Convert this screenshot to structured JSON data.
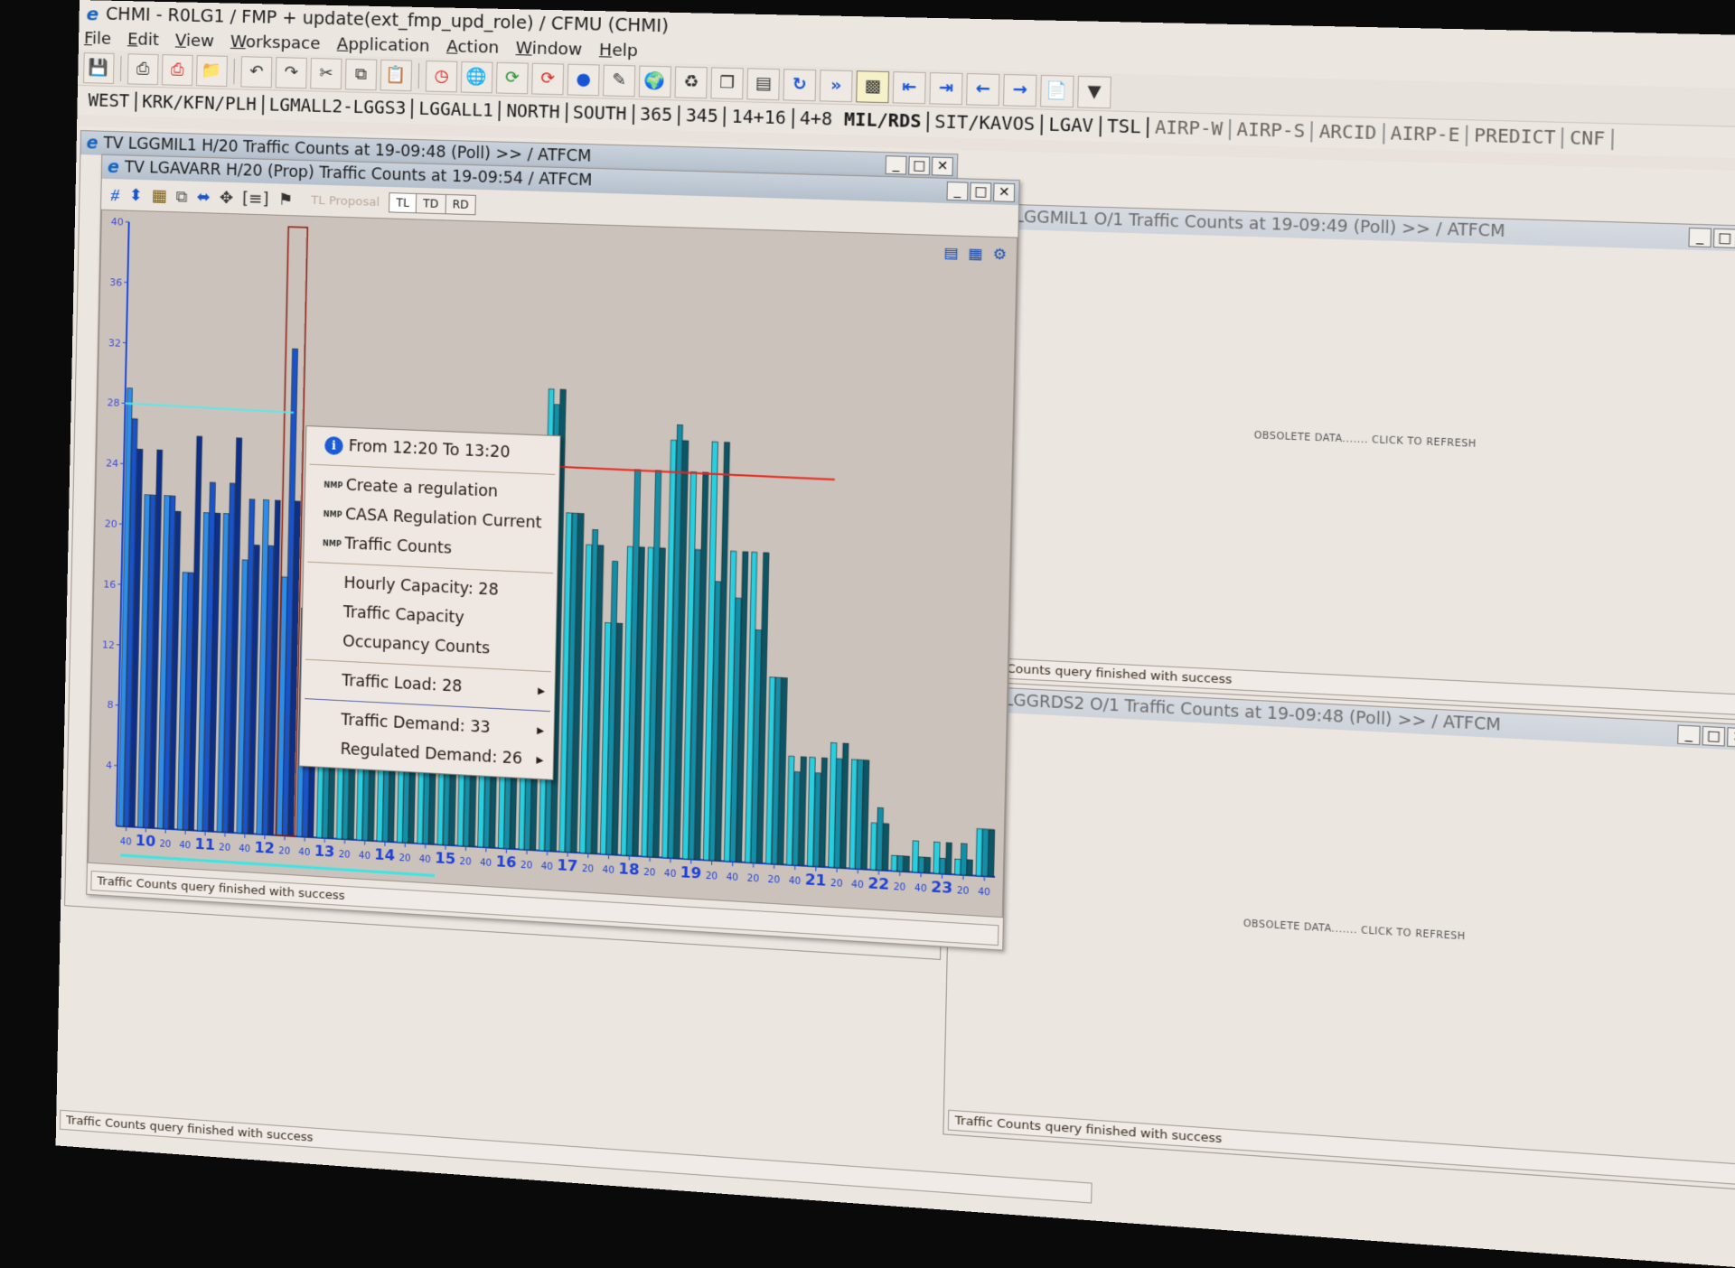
{
  "app": {
    "title": "CHMI - R0LG1 / FMP + update(ext_fmp_upd_role) / CFMU (CHMI)",
    "menu": [
      "File",
      "Edit",
      "View",
      "Workspace",
      "Application",
      "Action",
      "Window",
      "Help"
    ]
  },
  "toolbar": {
    "icons": [
      "save-icon",
      "print-icon",
      "print-color-icon",
      "open-folder-icon",
      "undo-icon",
      "redo-icon",
      "cut-icon",
      "copy-icon",
      "paste-icon",
      "clock-icon",
      "globe-icon",
      "refresh-green-icon",
      "refresh-red-icon",
      "teal-globe-icon",
      "edit-icon",
      "earth-icon",
      "recycle-icon",
      "tile-icon",
      "window-icon",
      "reload-icon",
      "fast-forward-icon",
      "np-icon",
      "first-icon",
      "last-icon",
      "back-icon",
      "forward-icon",
      "export-icon",
      "filter-icon"
    ]
  },
  "tv_tabs": [
    {
      "label": "WEST"
    },
    {
      "label": "KRK/KFN/PLH"
    },
    {
      "label": "LGMALL2-LGGS3"
    },
    {
      "label": "LGGALL1"
    },
    {
      "label": "NORTH"
    },
    {
      "label": "SOUTH"
    },
    {
      "label": "365"
    },
    {
      "label": "345"
    },
    {
      "label": "14+16"
    },
    {
      "label": "4+8"
    },
    {
      "label": "MIL/RDS"
    },
    {
      "label": "SIT/KAVOS"
    },
    {
      "label": "LGAV"
    },
    {
      "label": "TSL"
    },
    {
      "label": "AIRP-W"
    },
    {
      "label": "AIRP-S"
    },
    {
      "label": "ARCID"
    },
    {
      "label": "AIRP-E"
    },
    {
      "label": "PREDICT"
    },
    {
      "label": "CNF"
    }
  ],
  "windows": {
    "back_left": {
      "title": "TV LGGMIL1 H/20 Traffic Counts at 19-09:48 (Poll) >> / ATFCM"
    },
    "main": {
      "title": "TV LGAVARR H/20 (Prop) Traffic Counts at 19-09:54 / ATFCM",
      "tl_proposal_label": "TL Proposal",
      "toggles": [
        {
          "label": "TL",
          "selected": true
        },
        {
          "label": "TD",
          "selected": false
        },
        {
          "label": "RD",
          "selected": false
        }
      ],
      "status": "Traffic Counts query finished with success"
    },
    "right_top": {
      "title": "TV LGGMIL1 O/1 Traffic Counts at 19-09:49 (Poll) >> / ATFCM",
      "message": "OBSOLETE DATA....... CLICK TO REFRESH",
      "status": "Traffic Counts query finished with success"
    },
    "right_bottom": {
      "title": "TV LGGRDS2 O/1 Traffic Counts at 19-09:48 (Poll) >> / ATFCM",
      "message": "OBSOLETE DATA....... CLICK TO REFRESH",
      "status": "Traffic Counts query finished with success"
    },
    "lower_left_status": "Traffic Counts query finished with success"
  },
  "context_menu": {
    "header": "From 12:20 To 13:20",
    "nmp_items": [
      "Create a regulation",
      "CASA Regulation Current",
      "Traffic Counts"
    ],
    "info_items": [
      "Hourly Capacity:  28",
      "Traffic Capacity",
      "Occupancy Counts"
    ],
    "submenus": [
      "Traffic Load: 28",
      "Traffic Demand: 33",
      "Regulated Demand: 26"
    ]
  },
  "chart_data": {
    "type": "bar",
    "title": "TV LGAVARR H/20 (Prop) Traffic Counts",
    "xlabel": "",
    "ylabel": "",
    "ylim": [
      0,
      40
    ],
    "yticks": [
      4,
      8,
      12,
      16,
      20,
      24,
      28,
      32,
      36,
      40
    ],
    "grid": false,
    "capacity_line": {
      "value": 28,
      "range": "09:40-12:20"
    },
    "capacity_line_2": {
      "value": 25,
      "range": "12:20-20:40"
    },
    "selected_period": "12:20-13:20",
    "categories": [
      "09:40",
      "10:00",
      "10:20",
      "10:40",
      "11:00",
      "11:20",
      "11:40",
      "12:00",
      "12:20",
      "12:40",
      "13:00",
      "13:20",
      "13:40",
      "14:00",
      "14:20",
      "14:40",
      "15:00",
      "15:20",
      "15:40",
      "16:00",
      "16:20",
      "16:40",
      "17:00",
      "17:20",
      "17:40",
      "18:00",
      "18:20",
      "18:40",
      "19:00",
      "19:20",
      "19:40",
      "20:00",
      "20:20",
      "20:40",
      "21:00",
      "21:20",
      "21:40",
      "22:00",
      "22:20",
      "22:40",
      "23:00",
      "23:20",
      "23:40"
    ],
    "series": [
      {
        "name": "TL",
        "values": [
          29,
          22,
          22,
          17,
          21,
          21,
          18,
          22,
          17,
          15,
          22,
          22,
          22,
          22,
          22,
          22,
          22,
          22,
          22,
          22,
          22,
          30,
          22,
          20,
          15,
          20,
          20,
          27,
          25,
          27,
          20,
          20,
          12,
          7,
          7,
          8,
          7,
          3,
          1,
          2,
          2,
          1,
          3
        ]
      },
      {
        "name": "TD",
        "values": [
          27,
          22,
          22,
          17,
          23,
          23,
          22,
          19,
          32,
          15,
          22,
          22,
          22,
          22,
          22,
          22,
          22,
          22,
          22,
          22,
          22,
          29,
          22,
          21,
          19,
          25,
          25,
          28,
          20,
          18,
          17,
          15,
          12,
          6,
          6,
          7,
          7,
          4,
          1,
          1,
          1,
          2,
          3
        ]
      },
      {
        "name": "RD",
        "values": [
          25,
          25,
          21,
          26,
          21,
          26,
          19,
          22,
          22,
          15,
          22,
          22,
          22,
          22,
          22,
          22,
          22,
          22,
          22,
          22,
          22,
          30,
          22,
          20,
          15,
          20,
          20,
          27,
          25,
          27,
          20,
          20,
          12,
          7,
          7,
          8,
          7,
          3,
          1,
          1,
          2,
          1,
          3
        ]
      }
    ],
    "x_tick_labels": [
      "40",
      "10",
      "20",
      "40",
      "11",
      "20",
      "40",
      "12",
      "20",
      "40",
      "13",
      "20",
      "40",
      "14",
      "20",
      "40",
      "15",
      "20",
      "40",
      "16",
      "20",
      "40",
      "17",
      "20",
      "40",
      "18",
      "20",
      "40",
      "19",
      "20",
      "40",
      "20",
      "20",
      "40",
      "21",
      "20",
      "40",
      "22",
      "20",
      "40",
      "23",
      "20",
      "40"
    ]
  }
}
